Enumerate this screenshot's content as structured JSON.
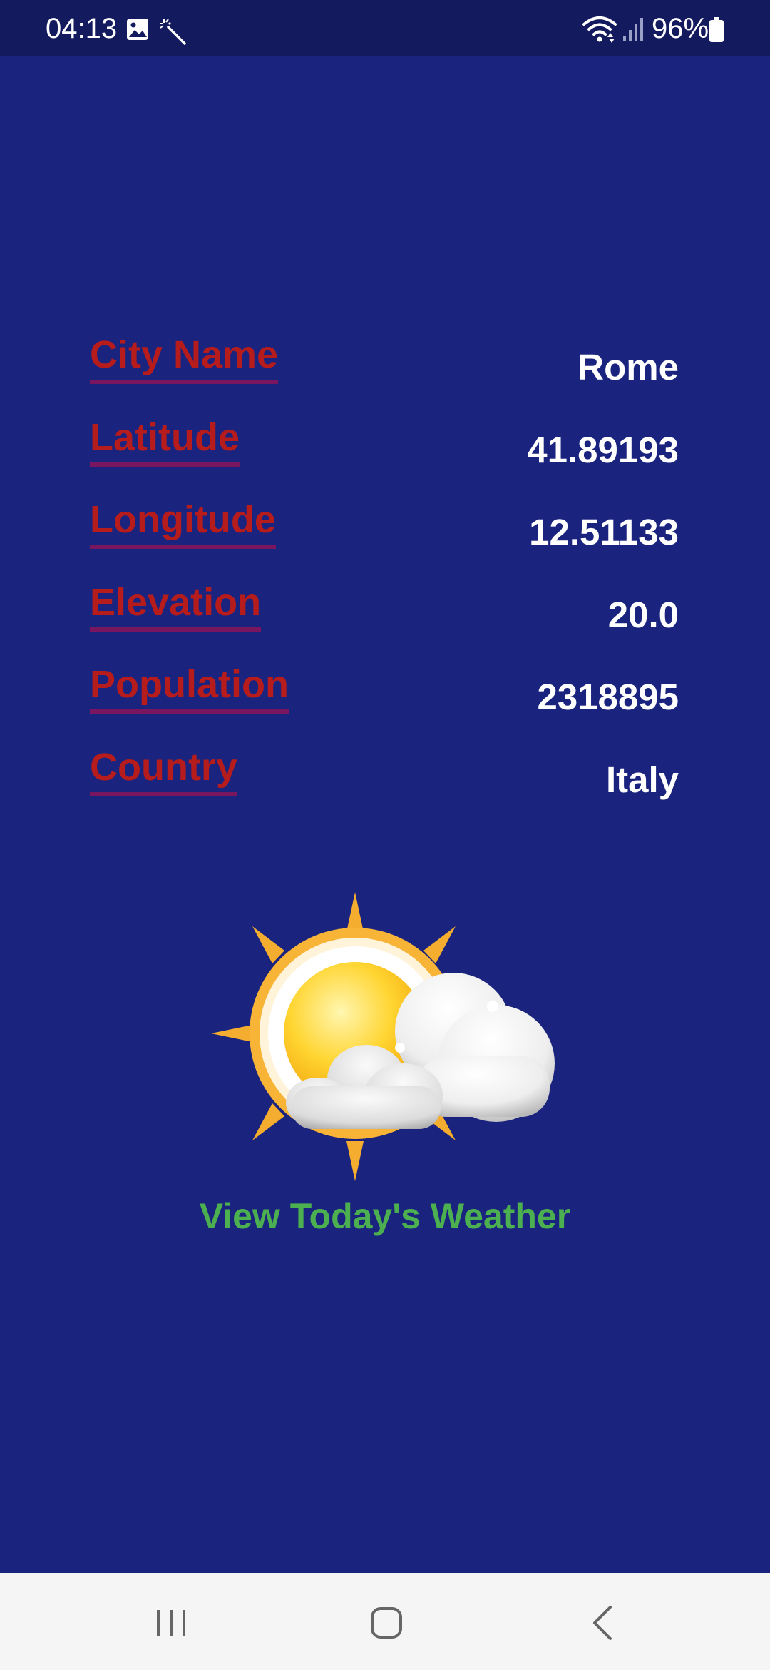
{
  "status_bar": {
    "time": "04:13",
    "battery": "96%",
    "icons": [
      "image-icon",
      "magic-wand-icon",
      "wifi-icon",
      "signal-icon",
      "battery-icon"
    ]
  },
  "info": {
    "rows": [
      {
        "label": "City Name",
        "value": "Rome"
      },
      {
        "label": "Latitude",
        "value": "41.89193"
      },
      {
        "label": "Longitude",
        "value": "12.51133"
      },
      {
        "label": "Elevation",
        "value": "20.0"
      },
      {
        "label": "Population",
        "value": "2318895"
      },
      {
        "label": "Country",
        "value": "Italy"
      }
    ]
  },
  "weather": {
    "icon": "partly-cloudy-icon",
    "link_label": "View Today's Weather"
  },
  "nav_bar": {
    "icons": [
      "recents-icon",
      "home-icon",
      "back-icon"
    ]
  },
  "colors": {
    "background": "#1a237e",
    "label": "#b71c1c",
    "value": "#ffffff",
    "link": "#4caf50"
  }
}
